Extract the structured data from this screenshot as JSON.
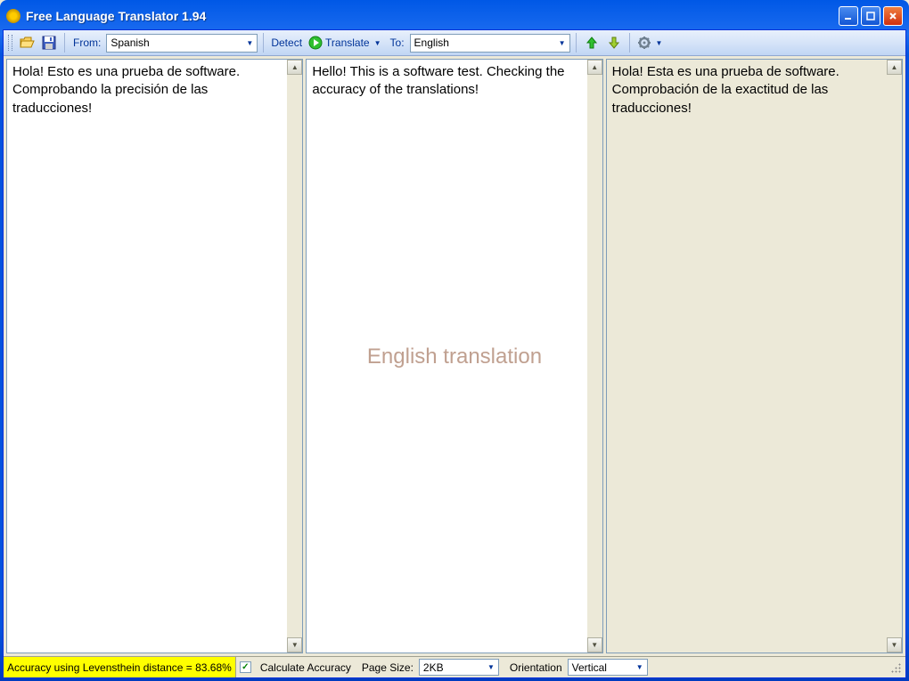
{
  "title": "Free Language Translator 1.94",
  "toolbar": {
    "from_label": "From:",
    "from_value": "Spanish",
    "detect_label": "Detect",
    "translate_label": "Translate",
    "to_label": "To:",
    "to_value": "English"
  },
  "panes": {
    "source": "Hola! Esto es una prueba de software. Comprobando la precisión de las traducciones!",
    "translation": "Hello! This is a software test. Checking the accuracy of the translations!",
    "watermark": "English translation",
    "back": "Hola! Esta es una prueba de software. Comprobación de la exactitud de las traducciones!"
  },
  "status": {
    "accuracy": "Accuracy using Levensthein distance = 83.68%",
    "calc_label": "Calculate Accuracy",
    "page_size_label": "Page Size:",
    "page_size_value": "2KB",
    "orientation_label": "Orientation",
    "orientation_value": "Vertical"
  }
}
